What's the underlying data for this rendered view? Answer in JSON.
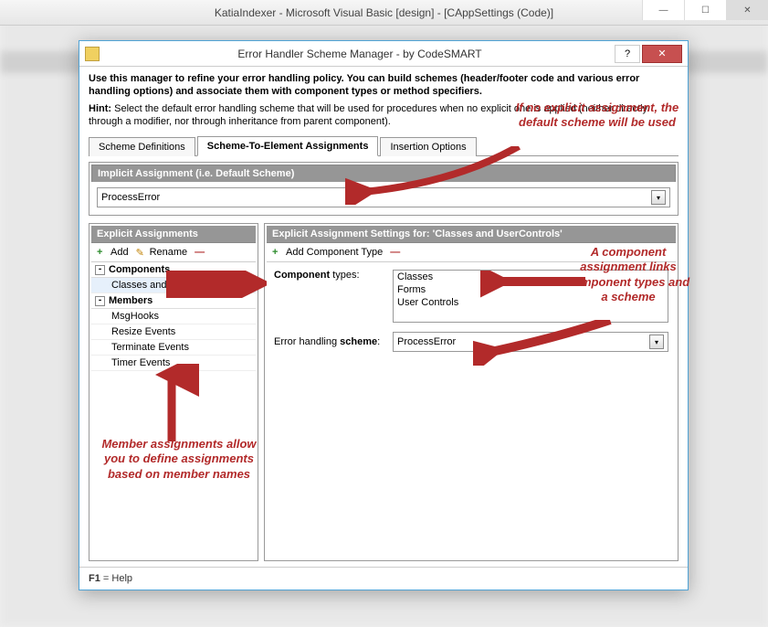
{
  "mainWindow": {
    "title": "KatiaIndexer - Microsoft Visual Basic [design] - [CAppSettings (Code)]"
  },
  "dialog": {
    "title": "Error Handler Scheme Manager - by CodeSMART",
    "intro": "Use this manager to refine your error handling policy. You can build schemes (header/footer code and various error handling options) and associate them with component types or method specifiers.",
    "hintLabel": "Hint:",
    "hintText": "Select the default error handling scheme that will be used for procedures when no explicit one is applied (neither directly through a modifier, nor through inheritance from parent component).",
    "tabs": [
      "Scheme Definitions",
      "Scheme-To-Element Assignments",
      "Insertion Options"
    ],
    "implicitHeader": "Implicit Assignment (i.e. Default Scheme)",
    "implicitValue": "ProcessError",
    "explicitHeader": "Explicit Assignments",
    "addLabel": "Add",
    "renameLabel": "Rename",
    "tree": {
      "group1": "Components",
      "g1items": [
        "Classes and UserControls"
      ],
      "group2": "Members",
      "g2items": [
        "MsgHooks",
        "Resize Events",
        "Terminate Events",
        "Timer Events"
      ]
    },
    "rightHeader": "Explicit Assignment Settings for: 'Classes and UserControls'",
    "addCompLabel": "Add Component Type",
    "compTypesLabel": "Component types:",
    "compTypes": [
      "Classes",
      "Forms",
      "User Controls"
    ],
    "schemeLabel": "Error handling scheme:",
    "schemeValue": "ProcessError",
    "footerKey": "F1",
    "footerText": " = Help"
  },
  "annotations": {
    "a1": "If no explicit assignment, the default scheme will be used",
    "a2": "A component assignment links component types and a scheme",
    "a3": "Member assignments allow you to define assignments based on member names"
  }
}
